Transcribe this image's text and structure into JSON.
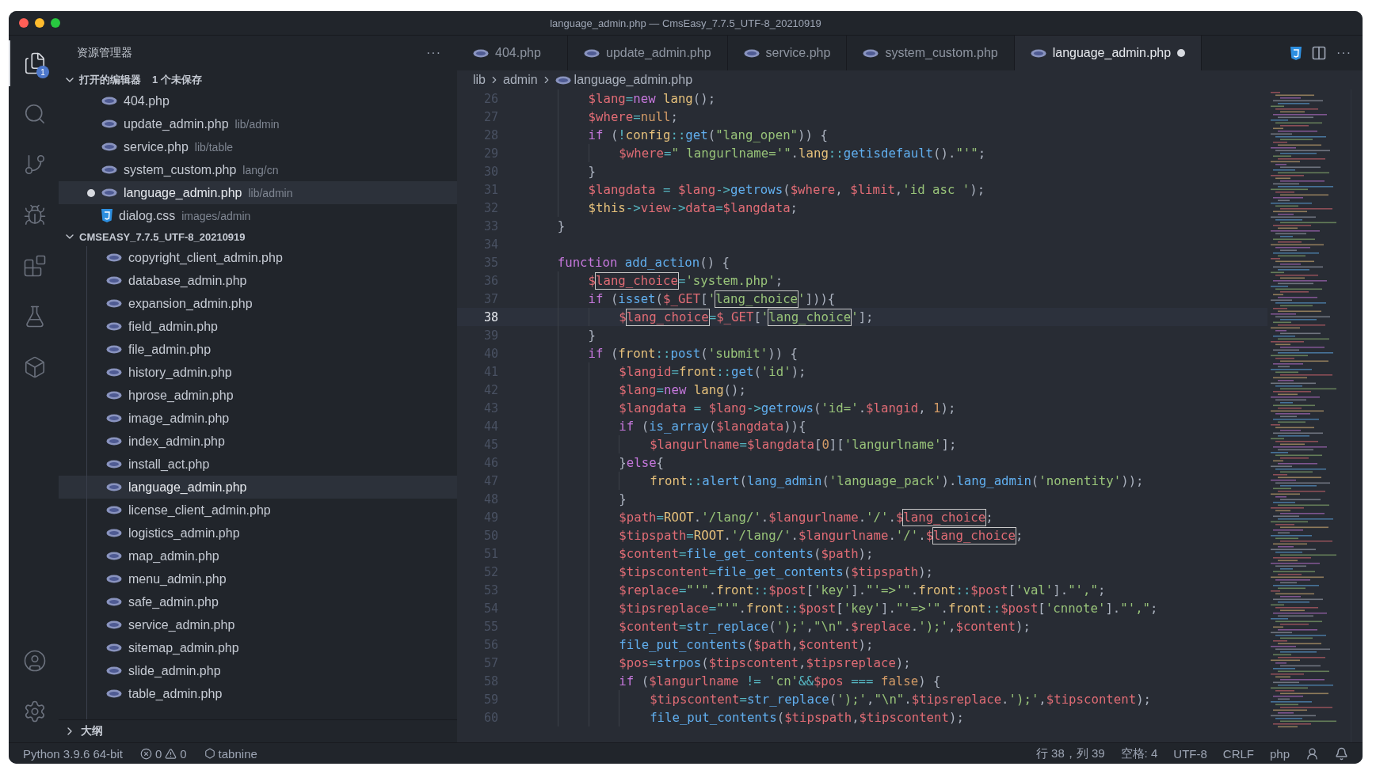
{
  "window": {
    "title": "language_admin.php — CmsEasy_7.7.5_UTF-8_20210919"
  },
  "activity_bar": [
    {
      "kind": "explorer",
      "selected": true,
      "badge": "1"
    },
    {
      "kind": "search",
      "selected": false
    },
    {
      "kind": "source-control",
      "selected": false
    },
    {
      "kind": "run-debug",
      "selected": false
    },
    {
      "kind": "extensions",
      "selected": false
    },
    {
      "kind": "testing",
      "selected": false
    },
    {
      "kind": "cube",
      "selected": false
    }
  ],
  "activity_bottom": [
    {
      "kind": "account"
    },
    {
      "kind": "settings"
    }
  ],
  "sidebar": {
    "title": "资源管理器",
    "more": "···",
    "open_editors": {
      "title": "打开的编辑器",
      "badge": "1 个未保存",
      "expanded": true,
      "items": [
        {
          "name": "404.php",
          "kind": "php",
          "modified": false,
          "selected": false
        },
        {
          "name": "update_admin.php",
          "path": "lib/admin",
          "kind": "php",
          "modified": false,
          "selected": false
        },
        {
          "name": "service.php",
          "path": "lib/table",
          "kind": "php",
          "modified": false,
          "selected": false
        },
        {
          "name": "system_custom.php",
          "path": "lang/cn",
          "kind": "php",
          "modified": false,
          "selected": false
        },
        {
          "name": "language_admin.php",
          "path": "lib/admin",
          "kind": "php",
          "modified": true,
          "selected": true
        },
        {
          "name": "dialog.css",
          "path": "images/admin",
          "kind": "css",
          "modified": false,
          "selected": false
        }
      ]
    },
    "folder": {
      "title": "CMSEASY_7.7.5_UTF-8_20210919",
      "expanded": true,
      "items": [
        {
          "name": "copyright_client_admin.php",
          "selected": false
        },
        {
          "name": "database_admin.php",
          "selected": false
        },
        {
          "name": "expansion_admin.php",
          "selected": false
        },
        {
          "name": "field_admin.php",
          "selected": false
        },
        {
          "name": "file_admin.php",
          "selected": false
        },
        {
          "name": "history_admin.php",
          "selected": false
        },
        {
          "name": "hprose_admin.php",
          "selected": false
        },
        {
          "name": "image_admin.php",
          "selected": false
        },
        {
          "name": "index_admin.php",
          "selected": false
        },
        {
          "name": "install_act.php",
          "selected": false
        },
        {
          "name": "language_admin.php",
          "selected": true
        },
        {
          "name": "license_client_admin.php",
          "selected": false
        },
        {
          "name": "logistics_admin.php",
          "selected": false
        },
        {
          "name": "map_admin.php",
          "selected": false
        },
        {
          "name": "menu_admin.php",
          "selected": false
        },
        {
          "name": "safe_admin.php",
          "selected": false
        },
        {
          "name": "service_admin.php",
          "selected": false
        },
        {
          "name": "sitemap_admin.php",
          "selected": false
        },
        {
          "name": "slide_admin.php",
          "selected": false
        },
        {
          "name": "table_admin.php",
          "selected": false
        }
      ]
    },
    "outline": {
      "title": "大纲",
      "expanded": false
    }
  },
  "tabs": [
    {
      "label": "404.php",
      "selected": false,
      "modified": false
    },
    {
      "label": "update_admin.php",
      "selected": false,
      "modified": false
    },
    {
      "label": "service.php",
      "selected": false,
      "modified": false
    },
    {
      "label": "system_custom.php",
      "selected": false,
      "modified": false
    },
    {
      "label": "language_admin.php",
      "selected": true,
      "modified": true
    }
  ],
  "tab_actions_more": "···",
  "breadcrumb": [
    "lib",
    "admin",
    "language_admin.php"
  ],
  "code": [
    {
      "number": "26",
      "selected": false,
      "tokens": [
        {
          "kind": "var",
          "text": "        $lang"
        },
        {
          "kind": "op",
          "text": "="
        },
        {
          "kind": "kw",
          "text": "new"
        },
        {
          "kind": "cls",
          "text": " lang"
        },
        {
          "kind": "txt",
          "text": "();"
        }
      ]
    },
    {
      "number": "27",
      "selected": false,
      "tokens": [
        {
          "kind": "var",
          "text": "        $where"
        },
        {
          "kind": "op",
          "text": "="
        },
        {
          "kind": "num",
          "text": "null"
        },
        {
          "kind": "txt",
          "text": ";"
        }
      ]
    },
    {
      "number": "28",
      "selected": false,
      "tokens": [
        {
          "kind": "kw",
          "text": "        if"
        },
        {
          "kind": "txt",
          "text": " ("
        },
        {
          "kind": "op",
          "text": "!"
        },
        {
          "kind": "cls",
          "text": "config"
        },
        {
          "kind": "op",
          "text": "::"
        },
        {
          "kind": "fn",
          "text": "get"
        },
        {
          "kind": "txt",
          "text": "("
        },
        {
          "kind": "str",
          "text": "\"lang_open\""
        },
        {
          "kind": "txt",
          "text": ")) {"
        }
      ]
    },
    {
      "number": "29",
      "selected": false,
      "tokens": [
        {
          "kind": "var",
          "text": "            $where"
        },
        {
          "kind": "op",
          "text": "="
        },
        {
          "kind": "str",
          "text": "\" langurlname='\""
        },
        {
          "kind": "txt",
          "text": "."
        },
        {
          "kind": "cls",
          "text": "lang"
        },
        {
          "kind": "op",
          "text": "::"
        },
        {
          "kind": "fn",
          "text": "getisdefault"
        },
        {
          "kind": "txt",
          "text": "()."
        },
        {
          "kind": "str",
          "text": "\"'\""
        },
        {
          "kind": "txt",
          "text": ";"
        }
      ]
    },
    {
      "number": "30",
      "selected": false,
      "tokens": [
        {
          "kind": "txt",
          "text": "        }"
        }
      ]
    },
    {
      "number": "31",
      "selected": false,
      "tokens": [
        {
          "kind": "var",
          "text": "        $langdata"
        },
        {
          "kind": "op",
          "text": " = "
        },
        {
          "kind": "var",
          "text": "$lang"
        },
        {
          "kind": "op",
          "text": "->"
        },
        {
          "kind": "fn",
          "text": "getrows"
        },
        {
          "kind": "txt",
          "text": "("
        },
        {
          "kind": "var",
          "text": "$where"
        },
        {
          "kind": "txt",
          "text": ", "
        },
        {
          "kind": "var",
          "text": "$limit"
        },
        {
          "kind": "txt",
          "text": ","
        },
        {
          "kind": "str",
          "text": "'id asc '"
        },
        {
          "kind": "txt",
          "text": ");"
        }
      ]
    },
    {
      "number": "32",
      "selected": false,
      "tokens": [
        {
          "kind": "cls",
          "text": "        $this"
        },
        {
          "kind": "op",
          "text": "->"
        },
        {
          "kind": "var",
          "text": "view"
        },
        {
          "kind": "op",
          "text": "->"
        },
        {
          "kind": "var",
          "text": "data"
        },
        {
          "kind": "op",
          "text": "="
        },
        {
          "kind": "var",
          "text": "$langdata"
        },
        {
          "kind": "txt",
          "text": ";"
        }
      ]
    },
    {
      "number": "33",
      "selected": false,
      "tokens": [
        {
          "kind": "txt",
          "text": "    }"
        }
      ]
    },
    {
      "number": "34",
      "selected": false
    },
    {
      "number": "35",
      "selected": false,
      "tokens": [
        {
          "kind": "kw",
          "text": "    function"
        },
        {
          "kind": "fn",
          "text": " add_action"
        },
        {
          "kind": "txt",
          "text": "() {"
        }
      ]
    },
    {
      "number": "36",
      "selected": false,
      "tokens": [
        {
          "kind": "var",
          "text": "        $"
        },
        {
          "kind": "varbox",
          "text": "lang_choice"
        },
        {
          "kind": "op",
          "text": "="
        },
        {
          "kind": "str",
          "text": "'system.php'"
        },
        {
          "kind": "txt",
          "text": ";"
        }
      ]
    },
    {
      "number": "37",
      "selected": false,
      "tokens": [
        {
          "kind": "kw",
          "text": "        if"
        },
        {
          "kind": "txt",
          "text": " ("
        },
        {
          "kind": "fn",
          "text": "isset"
        },
        {
          "kind": "txt",
          "text": "("
        },
        {
          "kind": "var",
          "text": "$_GET"
        },
        {
          "kind": "txt",
          "text": "["
        },
        {
          "kind": "str",
          "text": "'"
        },
        {
          "kind": "strbox",
          "text": "lang_choice"
        },
        {
          "kind": "str",
          "text": "'"
        },
        {
          "kind": "txt",
          "text": "])){"
        }
      ]
    },
    {
      "number": "38",
      "selected": true,
      "tokens": [
        {
          "kind": "var",
          "text": "            $"
        },
        {
          "kind": "varbox",
          "text": "lang_choice"
        },
        {
          "kind": "op",
          "text": "="
        },
        {
          "kind": "var",
          "text": "$_GET"
        },
        {
          "kind": "txt",
          "text": "["
        },
        {
          "kind": "str",
          "text": "'"
        },
        {
          "kind": "strbox",
          "text": "lang_choice"
        },
        {
          "kind": "str",
          "text": "'"
        },
        {
          "kind": "txt",
          "text": "];"
        }
      ]
    },
    {
      "number": "39",
      "selected": false,
      "tokens": [
        {
          "kind": "txt",
          "text": "        }"
        }
      ]
    },
    {
      "number": "40",
      "selected": false,
      "tokens": [
        {
          "kind": "kw",
          "text": "        if"
        },
        {
          "kind": "txt",
          "text": " ("
        },
        {
          "kind": "cls",
          "text": "front"
        },
        {
          "kind": "op",
          "text": "::"
        },
        {
          "kind": "fn",
          "text": "post"
        },
        {
          "kind": "txt",
          "text": "("
        },
        {
          "kind": "str",
          "text": "'submit'"
        },
        {
          "kind": "txt",
          "text": ")) {"
        }
      ]
    },
    {
      "number": "41",
      "selected": false,
      "tokens": [
        {
          "kind": "var",
          "text": "            $langid"
        },
        {
          "kind": "op",
          "text": "="
        },
        {
          "kind": "cls",
          "text": "front"
        },
        {
          "kind": "op",
          "text": "::"
        },
        {
          "kind": "fn",
          "text": "get"
        },
        {
          "kind": "txt",
          "text": "("
        },
        {
          "kind": "str",
          "text": "'id'"
        },
        {
          "kind": "txt",
          "text": ");"
        }
      ]
    },
    {
      "number": "42",
      "selected": false,
      "tokens": [
        {
          "kind": "var",
          "text": "            $lang"
        },
        {
          "kind": "op",
          "text": "="
        },
        {
          "kind": "kw",
          "text": "new"
        },
        {
          "kind": "cls",
          "text": " lang"
        },
        {
          "kind": "txt",
          "text": "();"
        }
      ]
    },
    {
      "number": "43",
      "selected": false,
      "tokens": [
        {
          "kind": "var",
          "text": "            $langdata"
        },
        {
          "kind": "op",
          "text": " = "
        },
        {
          "kind": "var",
          "text": "$lang"
        },
        {
          "kind": "op",
          "text": "->"
        },
        {
          "kind": "fn",
          "text": "getrows"
        },
        {
          "kind": "txt",
          "text": "("
        },
        {
          "kind": "str",
          "text": "'id='"
        },
        {
          "kind": "txt",
          "text": "."
        },
        {
          "kind": "var",
          "text": "$langid"
        },
        {
          "kind": "txt",
          "text": ", "
        },
        {
          "kind": "num",
          "text": "1"
        },
        {
          "kind": "txt",
          "text": ");"
        }
      ]
    },
    {
      "number": "44",
      "selected": false,
      "tokens": [
        {
          "kind": "kw",
          "text": "            if"
        },
        {
          "kind": "txt",
          "text": " ("
        },
        {
          "kind": "fn",
          "text": "is_array"
        },
        {
          "kind": "txt",
          "text": "("
        },
        {
          "kind": "var",
          "text": "$langdata"
        },
        {
          "kind": "txt",
          "text": ")){"
        }
      ]
    },
    {
      "number": "45",
      "selected": false,
      "tokens": [
        {
          "kind": "var",
          "text": "                $langurlname"
        },
        {
          "kind": "op",
          "text": "="
        },
        {
          "kind": "var",
          "text": "$langdata"
        },
        {
          "kind": "txt",
          "text": "["
        },
        {
          "kind": "num",
          "text": "0"
        },
        {
          "kind": "txt",
          "text": "]["
        },
        {
          "kind": "str",
          "text": "'langurlname'"
        },
        {
          "kind": "txt",
          "text": "];"
        }
      ]
    },
    {
      "number": "46",
      "selected": false,
      "tokens": [
        {
          "kind": "txt",
          "text": "            }"
        },
        {
          "kind": "kw",
          "text": "else"
        },
        {
          "kind": "txt",
          "text": "{"
        }
      ]
    },
    {
      "number": "47",
      "selected": false,
      "tokens": [
        {
          "kind": "cls",
          "text": "                front"
        },
        {
          "kind": "op",
          "text": "::"
        },
        {
          "kind": "fn",
          "text": "alert"
        },
        {
          "kind": "txt",
          "text": "("
        },
        {
          "kind": "fn",
          "text": "lang_admin"
        },
        {
          "kind": "txt",
          "text": "("
        },
        {
          "kind": "str",
          "text": "'language_pack'"
        },
        {
          "kind": "txt",
          "text": ")."
        },
        {
          "kind": "fn",
          "text": "lang_admin"
        },
        {
          "kind": "txt",
          "text": "("
        },
        {
          "kind": "str",
          "text": "'nonentity'"
        },
        {
          "kind": "txt",
          "text": "));"
        }
      ]
    },
    {
      "number": "48",
      "selected": false,
      "tokens": [
        {
          "kind": "txt",
          "text": "            }"
        }
      ]
    },
    {
      "number": "49",
      "selected": false,
      "tokens": [
        {
          "kind": "var",
          "text": "            $path"
        },
        {
          "kind": "op",
          "text": "="
        },
        {
          "kind": "cls",
          "text": "ROOT"
        },
        {
          "kind": "txt",
          "text": "."
        },
        {
          "kind": "str",
          "text": "'/lang/'"
        },
        {
          "kind": "txt",
          "text": "."
        },
        {
          "kind": "var",
          "text": "$langurlname"
        },
        {
          "kind": "txt",
          "text": "."
        },
        {
          "kind": "str",
          "text": "'/'"
        },
        {
          "kind": "txt",
          "text": "."
        },
        {
          "kind": "var",
          "text": "$"
        },
        {
          "kind": "varbox",
          "text": "lang_choice"
        },
        {
          "kind": "txt",
          "text": ";"
        }
      ]
    },
    {
      "number": "50",
      "selected": false,
      "tokens": [
        {
          "kind": "var",
          "text": "            $tipspath"
        },
        {
          "kind": "op",
          "text": "="
        },
        {
          "kind": "cls",
          "text": "ROOT"
        },
        {
          "kind": "txt",
          "text": "."
        },
        {
          "kind": "str",
          "text": "'/lang/'"
        },
        {
          "kind": "txt",
          "text": "."
        },
        {
          "kind": "var",
          "text": "$langurlname"
        },
        {
          "kind": "txt",
          "text": "."
        },
        {
          "kind": "str",
          "text": "'/'"
        },
        {
          "kind": "txt",
          "text": "."
        },
        {
          "kind": "var",
          "text": "$"
        },
        {
          "kind": "varbox",
          "text": "lang_choice"
        },
        {
          "kind": "txt",
          "text": ";"
        }
      ]
    },
    {
      "number": "51",
      "selected": false,
      "tokens": [
        {
          "kind": "var",
          "text": "            $content"
        },
        {
          "kind": "op",
          "text": "="
        },
        {
          "kind": "fn",
          "text": "file_get_contents"
        },
        {
          "kind": "txt",
          "text": "("
        },
        {
          "kind": "var",
          "text": "$path"
        },
        {
          "kind": "txt",
          "text": ");"
        }
      ]
    },
    {
      "number": "52",
      "selected": false,
      "tokens": [
        {
          "kind": "var",
          "text": "            $tipscontent"
        },
        {
          "kind": "op",
          "text": "="
        },
        {
          "kind": "fn",
          "text": "file_get_contents"
        },
        {
          "kind": "txt",
          "text": "("
        },
        {
          "kind": "var",
          "text": "$tipspath"
        },
        {
          "kind": "txt",
          "text": ");"
        }
      ]
    },
    {
      "number": "53",
      "selected": false,
      "tokens": [
        {
          "kind": "var",
          "text": "            $replace"
        },
        {
          "kind": "op",
          "text": "="
        },
        {
          "kind": "str",
          "text": "\"'\""
        },
        {
          "kind": "txt",
          "text": "."
        },
        {
          "kind": "cls",
          "text": "front"
        },
        {
          "kind": "op",
          "text": "::"
        },
        {
          "kind": "var",
          "text": "$post"
        },
        {
          "kind": "txt",
          "text": "["
        },
        {
          "kind": "str",
          "text": "'key'"
        },
        {
          "kind": "txt",
          "text": "]."
        },
        {
          "kind": "str",
          "text": "\"'=>'\""
        },
        {
          "kind": "txt",
          "text": "."
        },
        {
          "kind": "cls",
          "text": "front"
        },
        {
          "kind": "op",
          "text": "::"
        },
        {
          "kind": "var",
          "text": "$post"
        },
        {
          "kind": "txt",
          "text": "["
        },
        {
          "kind": "str",
          "text": "'val'"
        },
        {
          "kind": "txt",
          "text": "]."
        },
        {
          "kind": "str",
          "text": "\"',\""
        },
        {
          "kind": "txt",
          "text": ";"
        }
      ]
    },
    {
      "number": "54",
      "selected": false,
      "tokens": [
        {
          "kind": "var",
          "text": "            $tipsreplace"
        },
        {
          "kind": "op",
          "text": "="
        },
        {
          "kind": "str",
          "text": "\"'\""
        },
        {
          "kind": "txt",
          "text": "."
        },
        {
          "kind": "cls",
          "text": "front"
        },
        {
          "kind": "op",
          "text": "::"
        },
        {
          "kind": "var",
          "text": "$post"
        },
        {
          "kind": "txt",
          "text": "["
        },
        {
          "kind": "str",
          "text": "'key'"
        },
        {
          "kind": "txt",
          "text": "]."
        },
        {
          "kind": "str",
          "text": "\"'=>'\""
        },
        {
          "kind": "txt",
          "text": "."
        },
        {
          "kind": "cls",
          "text": "front"
        },
        {
          "kind": "op",
          "text": "::"
        },
        {
          "kind": "var",
          "text": "$post"
        },
        {
          "kind": "txt",
          "text": "["
        },
        {
          "kind": "str",
          "text": "'cnnote'"
        },
        {
          "kind": "txt",
          "text": "]."
        },
        {
          "kind": "str",
          "text": "\"',\""
        },
        {
          "kind": "txt",
          "text": ";"
        }
      ]
    },
    {
      "number": "55",
      "selected": false,
      "tokens": [
        {
          "kind": "var",
          "text": "            $content"
        },
        {
          "kind": "op",
          "text": "="
        },
        {
          "kind": "fn",
          "text": "str_replace"
        },
        {
          "kind": "txt",
          "text": "("
        },
        {
          "kind": "str",
          "text": "');'"
        },
        {
          "kind": "txt",
          "text": ","
        },
        {
          "kind": "str",
          "text": "\"\\n\""
        },
        {
          "kind": "txt",
          "text": "."
        },
        {
          "kind": "var",
          "text": "$replace"
        },
        {
          "kind": "txt",
          "text": "."
        },
        {
          "kind": "str",
          "text": "');'"
        },
        {
          "kind": "txt",
          "text": ","
        },
        {
          "kind": "var",
          "text": "$content"
        },
        {
          "kind": "txt",
          "text": ");"
        }
      ]
    },
    {
      "number": "56",
      "selected": false,
      "tokens": [
        {
          "kind": "fn",
          "text": "            file_put_contents"
        },
        {
          "kind": "txt",
          "text": "("
        },
        {
          "kind": "var",
          "text": "$path"
        },
        {
          "kind": "txt",
          "text": ","
        },
        {
          "kind": "var",
          "text": "$content"
        },
        {
          "kind": "txt",
          "text": ");"
        }
      ]
    },
    {
      "number": "57",
      "selected": false,
      "tokens": [
        {
          "kind": "var",
          "text": "            $pos"
        },
        {
          "kind": "op",
          "text": "="
        },
        {
          "kind": "fn",
          "text": "strpos"
        },
        {
          "kind": "txt",
          "text": "("
        },
        {
          "kind": "var",
          "text": "$tipscontent"
        },
        {
          "kind": "txt",
          "text": ","
        },
        {
          "kind": "var",
          "text": "$tipsreplace"
        },
        {
          "kind": "txt",
          "text": ");"
        }
      ]
    },
    {
      "number": "58",
      "selected": false,
      "tokens": [
        {
          "kind": "kw",
          "text": "            if"
        },
        {
          "kind": "txt",
          "text": " ("
        },
        {
          "kind": "var",
          "text": "$langurlname"
        },
        {
          "kind": "op",
          "text": " != "
        },
        {
          "kind": "str",
          "text": "'cn'"
        },
        {
          "kind": "op",
          "text": "&&"
        },
        {
          "kind": "var",
          "text": "$pos"
        },
        {
          "kind": "op",
          "text": " === "
        },
        {
          "kind": "num",
          "text": "false"
        },
        {
          "kind": "txt",
          "text": ") {"
        }
      ]
    },
    {
      "number": "59",
      "selected": false,
      "tokens": [
        {
          "kind": "var",
          "text": "                $tipscontent"
        },
        {
          "kind": "op",
          "text": "="
        },
        {
          "kind": "fn",
          "text": "str_replace"
        },
        {
          "kind": "txt",
          "text": "("
        },
        {
          "kind": "str",
          "text": "');'"
        },
        {
          "kind": "txt",
          "text": ","
        },
        {
          "kind": "str",
          "text": "\"\\n\""
        },
        {
          "kind": "txt",
          "text": "."
        },
        {
          "kind": "var",
          "text": "$tipsreplace"
        },
        {
          "kind": "txt",
          "text": "."
        },
        {
          "kind": "str",
          "text": "');'"
        },
        {
          "kind": "txt",
          "text": ","
        },
        {
          "kind": "var",
          "text": "$tipscontent"
        },
        {
          "kind": "txt",
          "text": ");"
        }
      ]
    },
    {
      "number": "60",
      "selected": false,
      "tokens": [
        {
          "kind": "fn",
          "text": "                file_put_contents"
        },
        {
          "kind": "txt",
          "text": "("
        },
        {
          "kind": "var",
          "text": "$tipspath"
        },
        {
          "kind": "txt",
          "text": ","
        },
        {
          "kind": "var",
          "text": "$tipscontent"
        },
        {
          "kind": "txt",
          "text": ");"
        }
      ]
    }
  ],
  "status_bar": {
    "interpreter": "Python 3.9.6 64-bit",
    "errors": "0",
    "warnings": "0",
    "tabnine": "tabnine",
    "right": [
      "行 38，列 39",
      "空格: 4",
      "UTF-8",
      "CRLF",
      "php"
    ]
  }
}
